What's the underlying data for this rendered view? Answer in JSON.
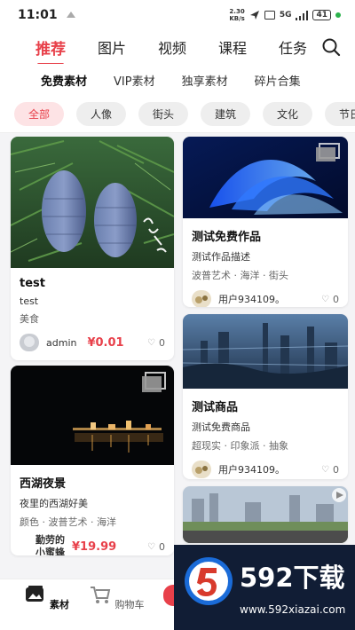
{
  "status": {
    "time": "11:01",
    "speed_top": "2.30",
    "speed_bottom": "KB/s",
    "signal": "5G",
    "battery": "41"
  },
  "nav": {
    "tabs": [
      {
        "label": "推荐"
      },
      {
        "label": "图片"
      },
      {
        "label": "视频"
      },
      {
        "label": "课程"
      },
      {
        "label": "任务"
      }
    ]
  },
  "subnav": {
    "items": [
      "免费素材",
      "VIP素材",
      "独享素材",
      "碎片合集"
    ]
  },
  "chips": [
    "全部",
    "人像",
    "街头",
    "建筑",
    "文化",
    "节日"
  ],
  "cards": {
    "c1": {
      "title": "test",
      "desc": "test",
      "tags": "美食",
      "user": "admin",
      "price": "¥0.01",
      "likes": "0"
    },
    "c2": {
      "title": "西湖夜景",
      "desc": "夜里的西湖好美",
      "tags": "颜色 · 波普艺术 · 海洋",
      "user_line1": "勤劳的",
      "user_line2": "小蜜蜂",
      "price": "¥19.99",
      "likes": "0"
    },
    "c3": {
      "title": "测试免费作品",
      "desc": "测试作品描述",
      "tags": "波普艺术 · 海洋 · 街头",
      "user": "用户934109。",
      "likes": "0"
    },
    "c4": {
      "title": "测试商品",
      "desc": "测试免费商品",
      "tags": "超现实 · 印象派 · 抽象",
      "user": "用户934109。",
      "likes": "0"
    }
  },
  "tabbar": {
    "material": "素材",
    "cart": "购物车"
  },
  "watermark": {
    "name": "592下载",
    "url": "www.592xiazai.com"
  },
  "colors": {
    "accent": "#e8404a"
  }
}
